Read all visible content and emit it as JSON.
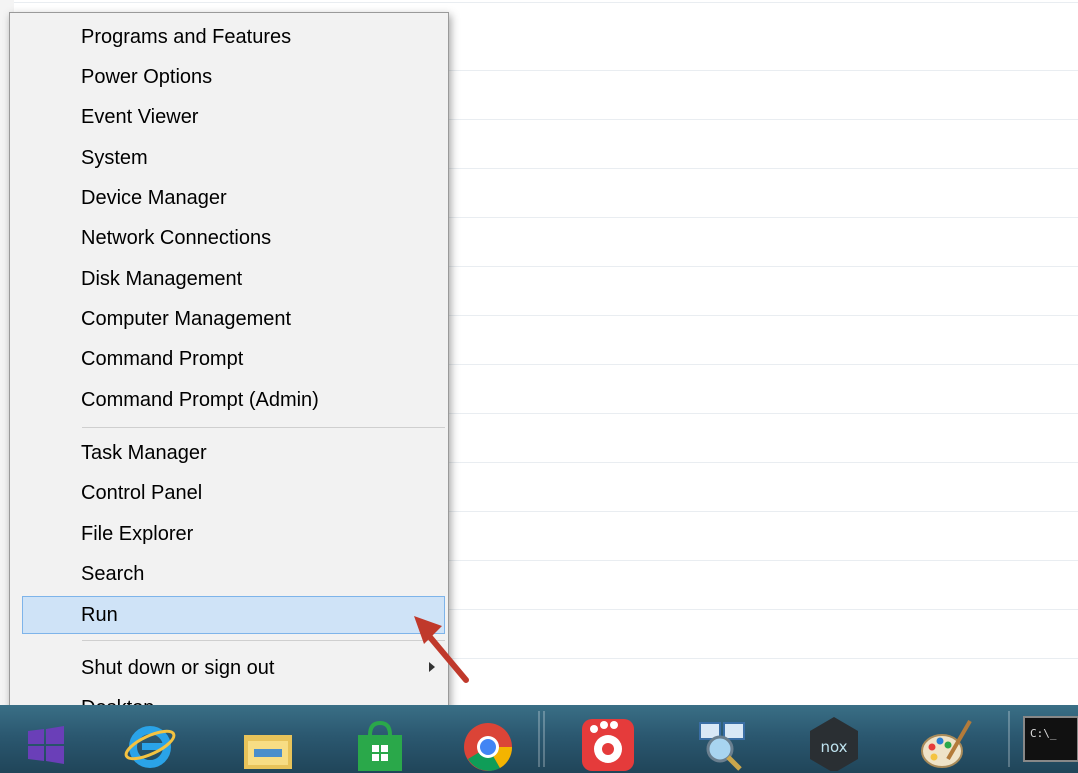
{
  "menu": {
    "groups": [
      [
        "Programs and Features",
        "Power Options",
        "Event Viewer",
        "System",
        "Device Manager",
        "Network Connections",
        "Disk Management",
        "Computer Management",
        "Command Prompt",
        "Command Prompt (Admin)"
      ],
      [
        "Task Manager",
        "Control Panel",
        "File Explorer",
        "Search",
        "Run"
      ],
      [
        "Shut down or sign out",
        "Desktop"
      ]
    ],
    "highlighted": "Run",
    "submenu_item": "Shut down or sign out"
  },
  "taskbar": {
    "items": [
      "start-icon",
      "internet-explorer-icon",
      "file-explorer-icon",
      "store-icon",
      "chrome-icon",
      "media-player-icon",
      "network-explorer-icon",
      "nox-icon",
      "paint-icon",
      "command-prompt-icon"
    ],
    "nox_label": "nox",
    "cmd_label": "C:\\_"
  },
  "colors": {
    "highlight": "#cfe3f7",
    "highlight_border": "#7eb4ea",
    "annotation_arrow": "#c0392b",
    "taskbar": "#2b5870"
  }
}
